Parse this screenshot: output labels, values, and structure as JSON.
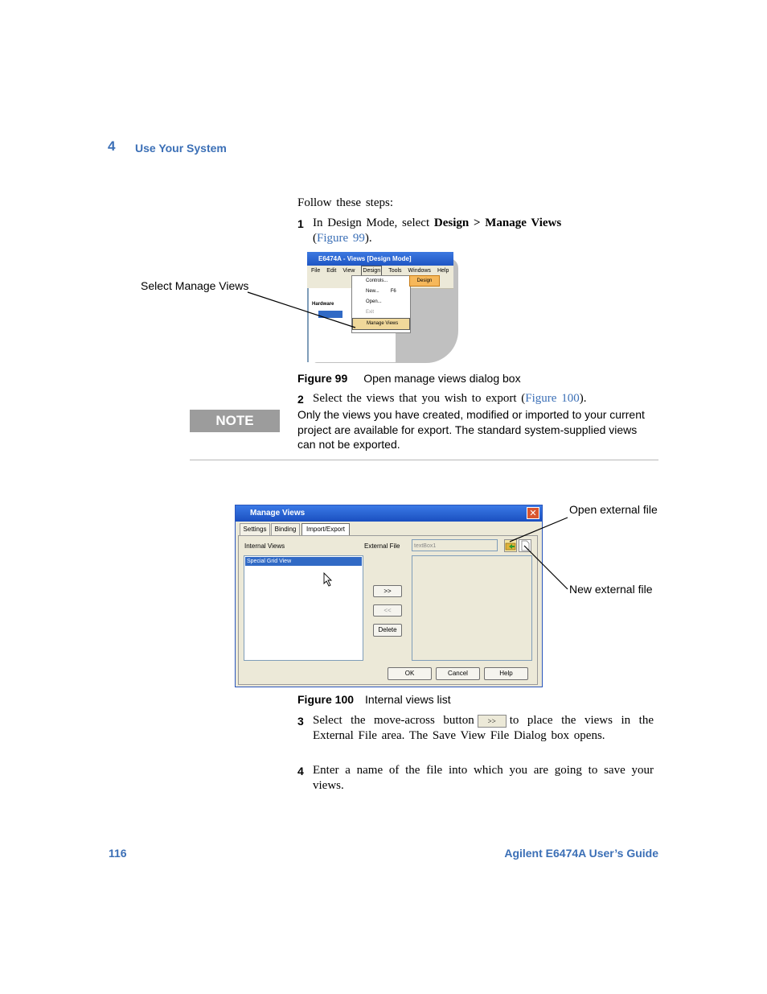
{
  "header": {
    "chapter": "4",
    "title": "Use Your System"
  },
  "intro": "Follow these steps:",
  "step1": {
    "num": "1",
    "pre": "In Design Mode, select ",
    "bold": "Design > Manage Views",
    "paren_open": "(",
    "link": "Figure 99",
    "paren_close": ")."
  },
  "fig99": {
    "callout": "Select Manage Views",
    "caption_label": "Figure 99",
    "caption_text": "Open manage views dialog box",
    "window_title": "E6474A - Views [Design Mode]",
    "menus": [
      "File",
      "Edit",
      "View",
      "Design",
      "Tools",
      "Windows",
      "Help"
    ],
    "menu_items": [
      "Controls...",
      "New...",
      "Open...",
      "Exit",
      "Manage Views"
    ],
    "new_shortcut": "F6",
    "design_button": "Design",
    "hardware_label": "Hardware"
  },
  "step2": {
    "num": "2",
    "text": "Select the views that you wish to export (",
    "link": "Figure 100",
    "close": ")."
  },
  "note": {
    "label": "NOTE",
    "text": "Only the views you have created, modified or imported to your current project are available for export. The standard system-supplied views can not be exported."
  },
  "fig100": {
    "window_title": "Manage Views",
    "tabs": [
      "Settings",
      "Binding",
      "Import/Export"
    ],
    "internal_views_label": "Internal Views",
    "external_file_label": "External File",
    "textbox_value": "textBox1",
    "list_items": [
      "Special Grid View"
    ],
    "buttons": {
      "move_right": ">>",
      "move_left": "<<",
      "delete": "Delete",
      "ok": "OK",
      "cancel": "Cancel",
      "help": "Help"
    },
    "callout_open": "Open external file",
    "callout_new": "New external file",
    "caption_label": "Figure 100",
    "caption_text": "Internal views list"
  },
  "step3": {
    "num": "3",
    "pre": "Select the move-across button",
    "btn": ">>",
    "post": "to place the views in the External File area. The Save View File Dialog box opens."
  },
  "step4": {
    "num": "4",
    "text": "Enter a name of the file into which you are going to save your views."
  },
  "footer": {
    "page": "116",
    "guide": "Agilent E6474A User’s Guide"
  },
  "colors": {
    "accent_blue": "#3b6fb6",
    "note_gray": "#9c9c9c"
  }
}
